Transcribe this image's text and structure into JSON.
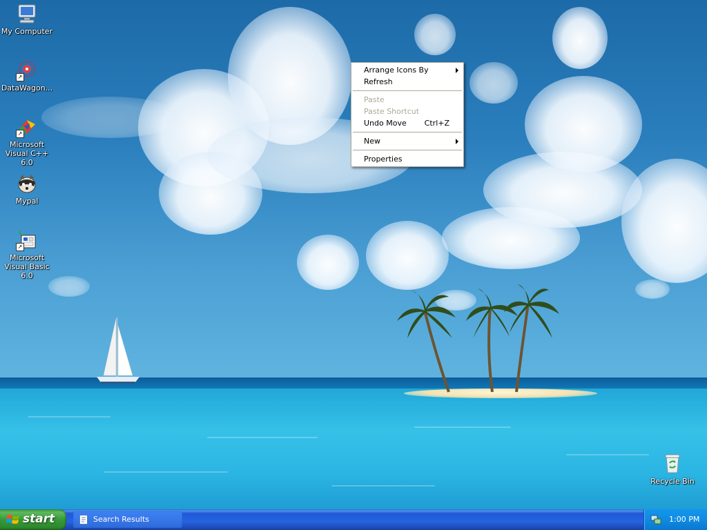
{
  "desktop_icons": [
    {
      "label": "My Computer",
      "icon": "my-computer-icon",
      "shortcut": false
    },
    {
      "label": "DataWagon...",
      "icon": "datawagon-icon",
      "shortcut": true
    },
    {
      "label": "Microsoft Visual C++ 6.0",
      "icon": "visual-cpp-icon",
      "shortcut": true
    },
    {
      "label": "Mypal",
      "icon": "mypal-icon",
      "shortcut": false
    },
    {
      "label": "Microsoft Visual Basic 6.0",
      "icon": "visual-basic-icon",
      "shortcut": true
    },
    {
      "label": "Recycle Bin",
      "icon": "recycle-bin-icon",
      "shortcut": false
    }
  ],
  "context_menu": {
    "items": [
      {
        "label": "Arrange Icons By",
        "submenu": true,
        "enabled": true
      },
      {
        "label": "Refresh",
        "submenu": false,
        "enabled": true
      },
      {
        "separator": true
      },
      {
        "label": "Paste",
        "submenu": false,
        "enabled": false
      },
      {
        "label": "Paste Shortcut",
        "submenu": false,
        "enabled": false
      },
      {
        "label": "Undo Move",
        "shortcut": "Ctrl+Z",
        "submenu": false,
        "enabled": true
      },
      {
        "separator": true
      },
      {
        "label": "New",
        "submenu": true,
        "enabled": true
      },
      {
        "separator": true
      },
      {
        "label": "Properties",
        "submenu": false,
        "enabled": true
      }
    ]
  },
  "taskbar": {
    "start_label": "start",
    "tasks": [
      {
        "label": "Search Results",
        "icon": "search-results-icon"
      }
    ],
    "tray": {
      "icon": "network-icon",
      "clock": "1:00 PM"
    }
  },
  "colors": {
    "taskbar_blue": "#2663e0",
    "start_green": "#379937",
    "tray_blue": "#0f8be0",
    "menu_disabled": "#aca899"
  }
}
